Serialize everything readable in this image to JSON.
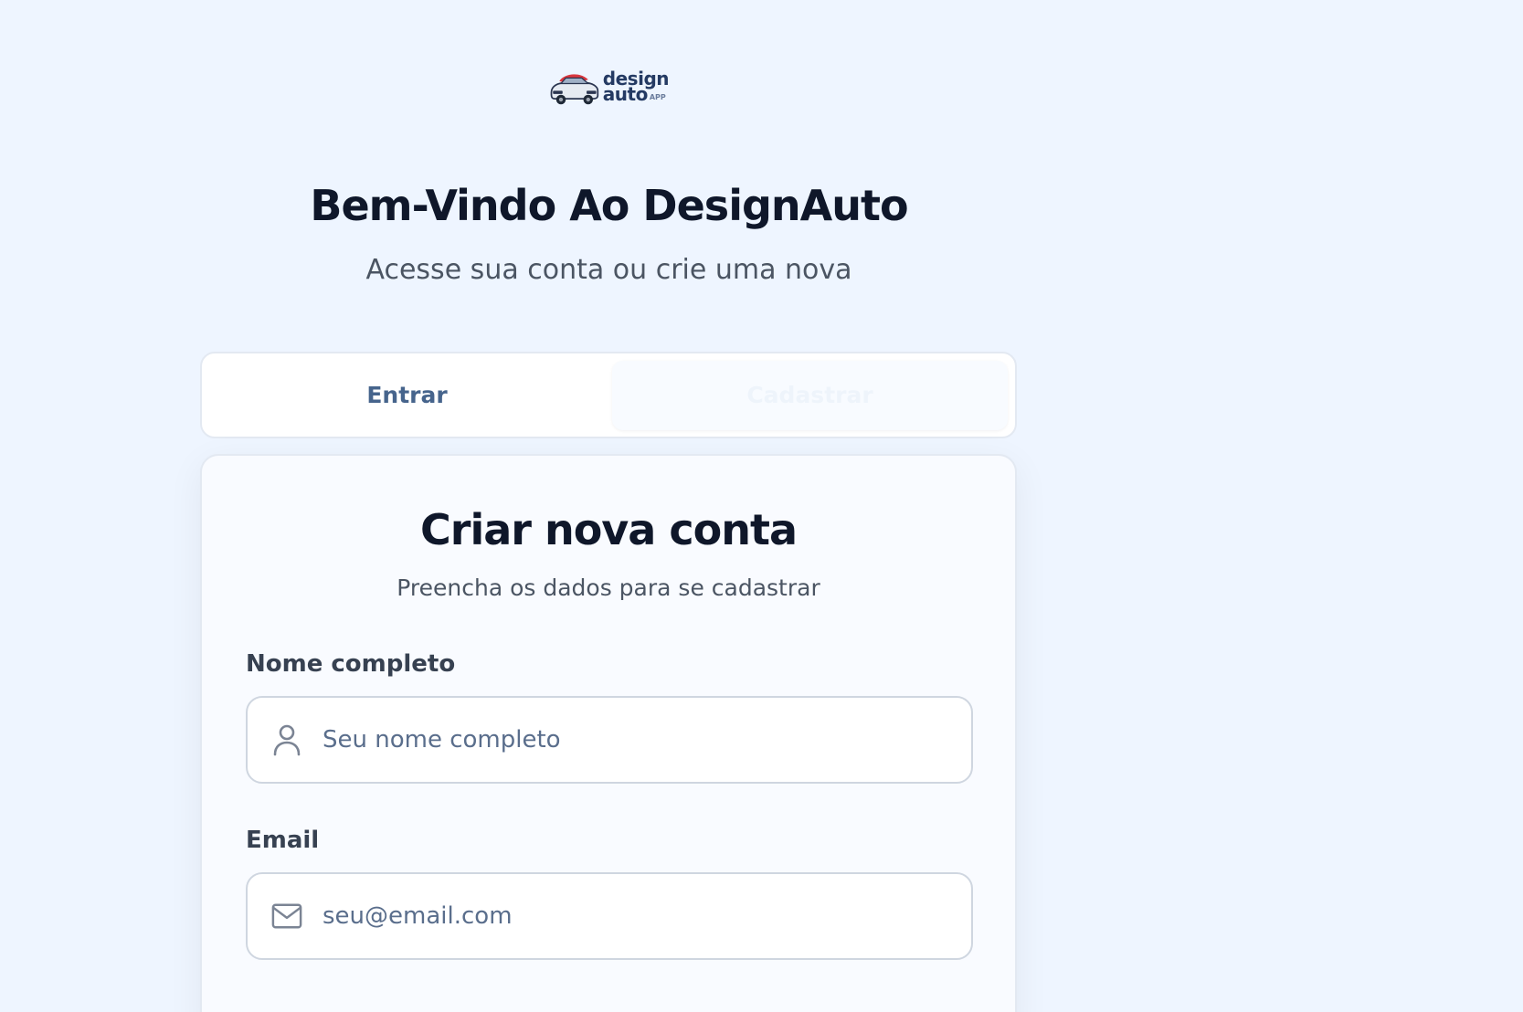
{
  "brand": {
    "logo_line1": "design",
    "logo_line2": "auto",
    "logo_suffix": "APP"
  },
  "header": {
    "title": "Bem-Vindo Ao DesignAuto",
    "subtitle": "Acesse sua conta ou crie uma nova"
  },
  "tabs": [
    {
      "label": "Entrar",
      "active": false
    },
    {
      "label": "Cadastrar",
      "active": true
    }
  ],
  "register_card": {
    "title": "Criar nova conta",
    "subtitle": "Preencha os dados para se cadastrar",
    "fields": [
      {
        "label": "Nome completo",
        "placeholder": "Seu nome completo",
        "value": "",
        "icon": "user-icon"
      },
      {
        "label": "Email",
        "placeholder": "seu@email.com",
        "value": "",
        "icon": "mail-icon"
      }
    ]
  },
  "colors": {
    "page_background": "#eef5ff",
    "heading": "#0f172a",
    "muted_text": "#4b5563",
    "tab_text": "#46648c",
    "brand_red": "#d9363e",
    "brand_navy": "#243a63"
  }
}
